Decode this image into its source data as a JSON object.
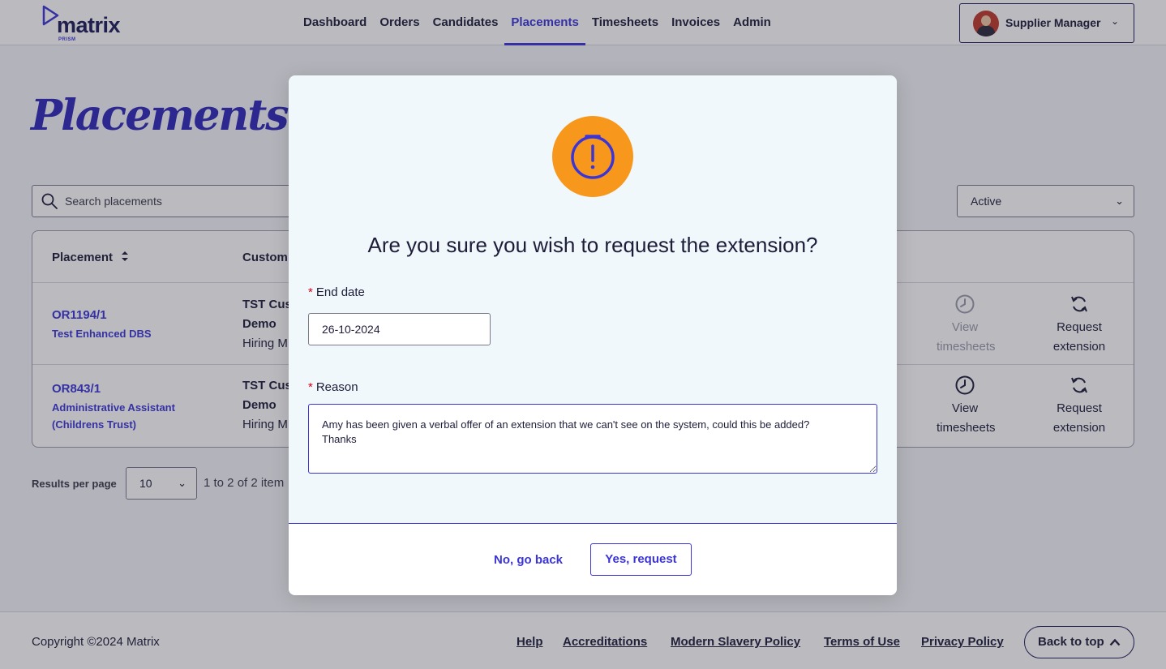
{
  "header": {
    "logo_text": "matrix",
    "logo_subtext": "PRISM",
    "nav": [
      {
        "label": "Dashboard",
        "active": false
      },
      {
        "label": "Orders",
        "active": false
      },
      {
        "label": "Candidates",
        "active": false
      },
      {
        "label": "Placements",
        "active": true
      },
      {
        "label": "Timesheets",
        "active": false
      },
      {
        "label": "Invoices",
        "active": false
      },
      {
        "label": "Admin",
        "active": false
      }
    ],
    "user_name": "Supplier Manager"
  },
  "page": {
    "title": "Placements",
    "search_placeholder": "Search placements",
    "status_filter": "Active",
    "columns": [
      "Placement",
      "Custom"
    ],
    "rows": [
      {
        "id": "OR1194/1",
        "title": "Test Enhanced DBS",
        "customer_line1": "TST Cus",
        "customer_line2": "Demo",
        "hiring": "Hiring M",
        "view_label": "View timesheets",
        "view_disabled": true,
        "request_label": "Request extension"
      },
      {
        "id": "OR843/1",
        "title": "Administrative Assistant (Childrens Trust)",
        "customer_line1": "TST Cus",
        "customer_line2": "Demo",
        "hiring": "Hiring M",
        "view_label": "View timesheets",
        "view_disabled": false,
        "request_label": "Request extension"
      }
    ],
    "results_per_page_label": "Results per page",
    "results_per_page": "10",
    "range_text": "1 to 2 of 2 item"
  },
  "modal": {
    "title": "Are you sure you wish to request the extension?",
    "end_date_label": "End date",
    "end_date_value": "26-10-2024",
    "reason_label": "Reason",
    "reason_value": "Amy has been given a verbal offer of an extension that we can't see on the system, could this be added?\nThanks",
    "required_marker": "*",
    "cancel_label": "No, go back",
    "confirm_label": "Yes, request"
  },
  "footer": {
    "copyright": "Copyright ©2024 Matrix",
    "links": [
      "Help",
      "Accreditations",
      "Modern Slavery Policy",
      "Terms of Use",
      "Privacy Policy"
    ],
    "back_to_top": "Back to top"
  },
  "colors": {
    "accent": "#3b35d8",
    "warning": "#f7981d",
    "required": "#d0021b"
  },
  "icons": [
    "search-icon",
    "chevron-down-icon",
    "sort-icon",
    "clock-icon",
    "refresh-icon",
    "warning-timer-icon",
    "chevron-up-icon"
  ]
}
